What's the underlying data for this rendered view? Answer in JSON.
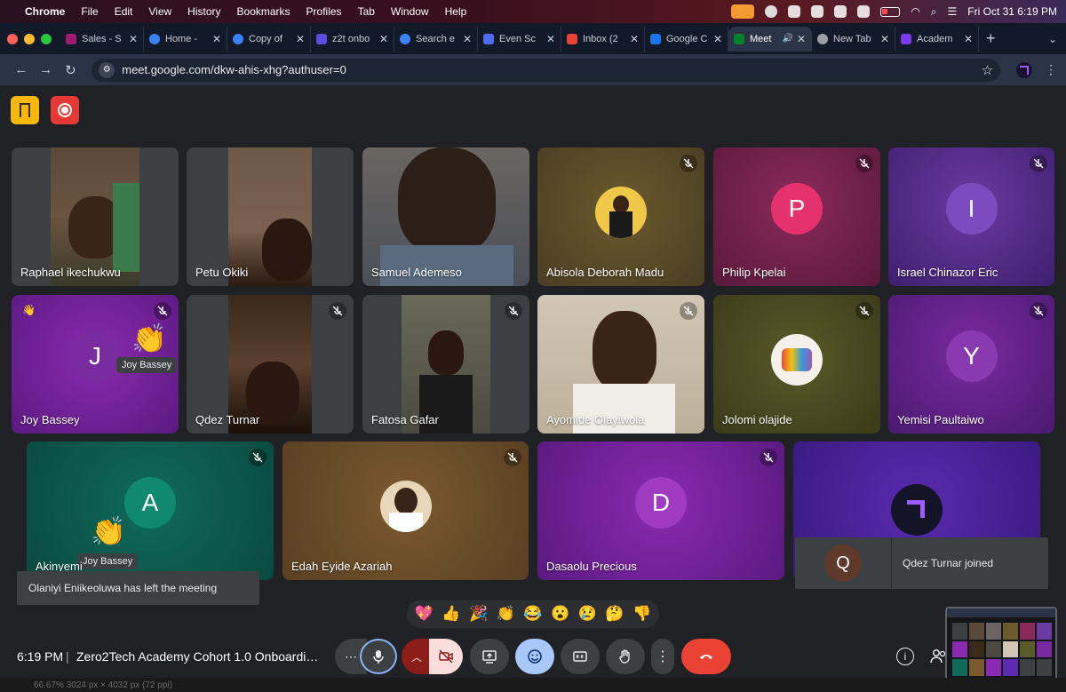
{
  "menubar": {
    "app": "Chrome",
    "items": [
      "File",
      "Edit",
      "View",
      "History",
      "Bookmarks",
      "Profiles",
      "Tab",
      "Window",
      "Help"
    ],
    "datetime": "Fri Oct 31  6:19 PM"
  },
  "tabs": [
    {
      "label": "Sales - S",
      "color": "#a01b6b"
    },
    {
      "label": "Home - ",
      "color": "#3b82f6"
    },
    {
      "label": "Copy of",
      "color": "#3b82f6"
    },
    {
      "label": "z2t onbo",
      "color": "#5b4de0"
    },
    {
      "label": "Search e",
      "color": "#3b82f6"
    },
    {
      "label": "Even Sc",
      "color": "#4c6ef5"
    },
    {
      "label": "Inbox (2",
      "color": "#ea4335"
    },
    {
      "label": "Google C",
      "color": "#1a73e8"
    },
    {
      "label": "Meet",
      "color": "#00832d",
      "active": true
    },
    {
      "label": "New Tab",
      "color": "#9aa0a6"
    },
    {
      "label": "Academ",
      "color": "#7c3aed"
    }
  ],
  "address": {
    "url": "meet.google.com/dkw-ahis-xhg?authuser=0"
  },
  "participants": {
    "raphael": {
      "name": "Raphael ikechukwu"
    },
    "petu": {
      "name": "Petu Okiki"
    },
    "samuel": {
      "name": "Samuel Ademeso"
    },
    "abisola": {
      "name": "Abisola Deborah Madu"
    },
    "philip": {
      "name": "Philip Kpelai",
      "initial": "P"
    },
    "israel": {
      "name": "Israel Chinazor Eric",
      "initial": "I"
    },
    "joy": {
      "name": "Joy Bassey",
      "initial": "J"
    },
    "qdez": {
      "name": "Qdez Turnar"
    },
    "fatosa": {
      "name": "Fatosa Gafar"
    },
    "ayomide": {
      "name": "Ayomide Olayiwola"
    },
    "jolomi": {
      "name": "Jolomi olajide"
    },
    "yemisi": {
      "name": "Yemisi Paultaiwo",
      "initial": "Y"
    },
    "akinyemi": {
      "name": "Akinyemi",
      "initial": "A"
    },
    "edah": {
      "name": "Edah Eyide Azariah"
    },
    "dasaolu": {
      "name": "Dasaolu Precious",
      "initial": "D"
    }
  },
  "reactions": {
    "tag1": "Joy Bassey",
    "tag2": "Joy Bassey"
  },
  "toasts": {
    "left": "Olaniyi Eniikeoluwa has left the meeting",
    "joined": "Qdez Turnar joined",
    "joined_initial": "Q"
  },
  "emoji_bar": [
    "💖",
    "👍",
    "🎉",
    "👏",
    "😂",
    "😮",
    "😢",
    "🤔",
    "👎"
  ],
  "bottom": {
    "time": "6:19 PM",
    "separator": "|",
    "meeting_title": "Zero2Tech Academy Cohort 1.0 Onboarding ..."
  },
  "statusline": "66.67%      3024 px × 4032 px (72 ppi)",
  "colors": {
    "accent_blue": "#8ab4f8",
    "end_call": "#ea4335",
    "raise_hand_badge": "#f6b80e"
  }
}
